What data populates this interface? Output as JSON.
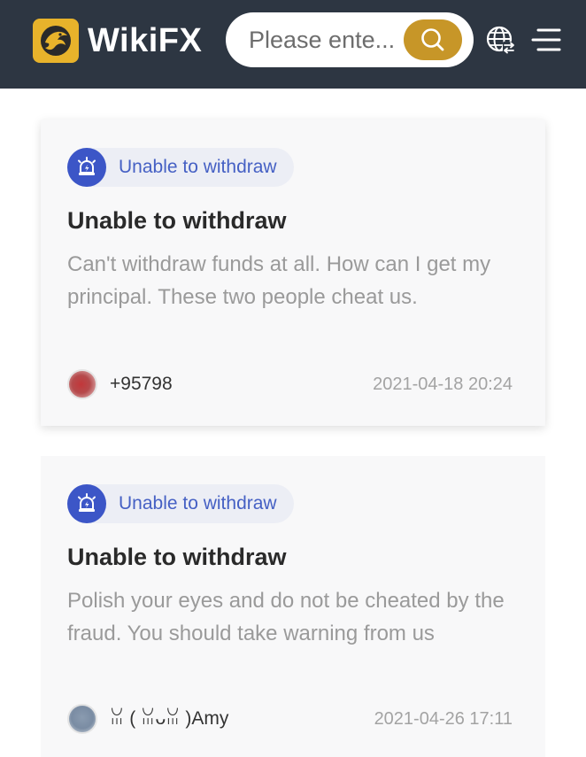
{
  "header": {
    "logo_text": "WikiFX",
    "search": {
      "placeholder": "Please ente..."
    },
    "icons": [
      "eagle-logo-icon",
      "search-icon",
      "globe-language-icon",
      "menu-icon"
    ]
  },
  "colors": {
    "header_bg": "#2d3642",
    "logo_gold": "#e8b32b",
    "search_button": "#c79628",
    "tag_blue": "#3c56c7",
    "tag_text": "#4560c4"
  },
  "cards": [
    {
      "tag": "Unable to withdraw",
      "tag_icon": "alarm-icon",
      "title": "Unable to withdraw",
      "body": "Can't withdraw funds at all. How can I get my principal. These two people cheat us.",
      "user": "+95798",
      "date": "2021-04-18 20:24"
    },
    {
      "tag": "Unable to withdraw",
      "tag_icon": "alarm-icon",
      "title": "Unable to withdraw",
      "body": "Polish your eyes and do not be cheated by the fraud. You should take warning from us",
      "user": "ꈍ ( ꈍᴗꈍ )Amy",
      "date": "2021-04-26 17:11"
    }
  ]
}
